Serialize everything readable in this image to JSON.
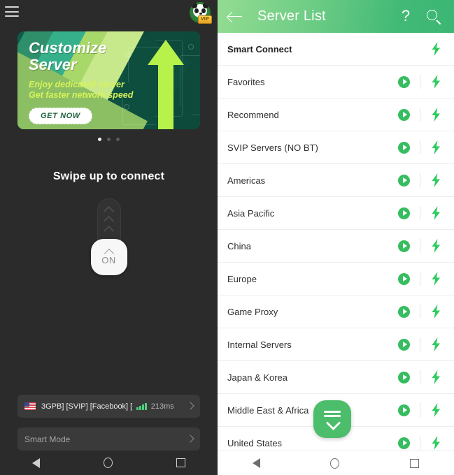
{
  "left_panel": {
    "menu_icon": "hamburger-menu-icon",
    "vip_badge_label": "VIP",
    "banner": {
      "title": "Customize\nServer",
      "subtitle": "Enjoy dedicated server\nGet faster network speed",
      "cta_label": "GET NOW",
      "dots_total": 3,
      "dot_active_index": 0
    },
    "swipe_label": "Swipe up to connect",
    "slider": {
      "knob_label": "ON",
      "chevron_icon": "chevron-up-icon"
    },
    "current_server": {
      "flag_icon": "us-flag-icon",
      "name": "3GPB] [SVIP] [Facebook] [",
      "signal_icon": "signal-bars-icon",
      "ping": "213ms",
      "chevron_icon": "chevron-right-icon"
    },
    "mode_row": {
      "label": "Smart Mode",
      "chevron_icon": "chevron-right-icon"
    },
    "navbar": {
      "back": "back-triangle-icon",
      "home": "home-circle-icon",
      "recents": "recents-square-icon"
    }
  },
  "right_panel": {
    "header": {
      "back_icon": "back-arrow-icon",
      "title": "Server List",
      "help_icon": "question-mark-icon",
      "help_glyph": "?",
      "search_icon": "search-icon"
    },
    "rows": [
      {
        "label": "Smart Connect",
        "bold": true,
        "has_play": false,
        "has_bolt": true
      },
      {
        "label": "Favorites",
        "bold": false,
        "has_play": true,
        "has_bolt": true
      },
      {
        "label": "Recommend",
        "bold": false,
        "has_play": true,
        "has_bolt": true
      },
      {
        "label": "SVIP Servers (NO BT)",
        "bold": false,
        "has_play": true,
        "has_bolt": true
      },
      {
        "label": "Americas",
        "bold": false,
        "has_play": true,
        "has_bolt": true
      },
      {
        "label": "Asia Pacific",
        "bold": false,
        "has_play": true,
        "has_bolt": true
      },
      {
        "label": "China",
        "bold": false,
        "has_play": true,
        "has_bolt": true
      },
      {
        "label": "Europe",
        "bold": false,
        "has_play": true,
        "has_bolt": true
      },
      {
        "label": "Game Proxy",
        "bold": false,
        "has_play": true,
        "has_bolt": true
      },
      {
        "label": "Internal Servers",
        "bold": false,
        "has_play": true,
        "has_bolt": true
      },
      {
        "label": "Japan & Korea",
        "bold": false,
        "has_play": true,
        "has_bolt": true
      },
      {
        "label": "Middle East & Africa",
        "bold": false,
        "has_play": true,
        "has_bolt": true
      },
      {
        "label": "United States",
        "bold": false,
        "has_play": true,
        "has_bolt": true
      }
    ],
    "fab": {
      "icon": "collapse-all-down-icon"
    },
    "navbar": {
      "back": "back-triangle-icon",
      "home": "home-circle-icon",
      "recents": "recents-square-icon"
    }
  },
  "colors": {
    "brand_green": "#3bb673",
    "header_light_green": "#93dc92",
    "bolt_green": "#2ecc5e",
    "play_green": "#37bd5f",
    "fab_green": "#4cbd6a",
    "dark_bg": "#2b2b2b",
    "card_bg": "#3a3a3a",
    "banner_lime": "#b6f24a",
    "banner_sub_text": "#d7f25a",
    "vip_gold": "#ffd451"
  }
}
